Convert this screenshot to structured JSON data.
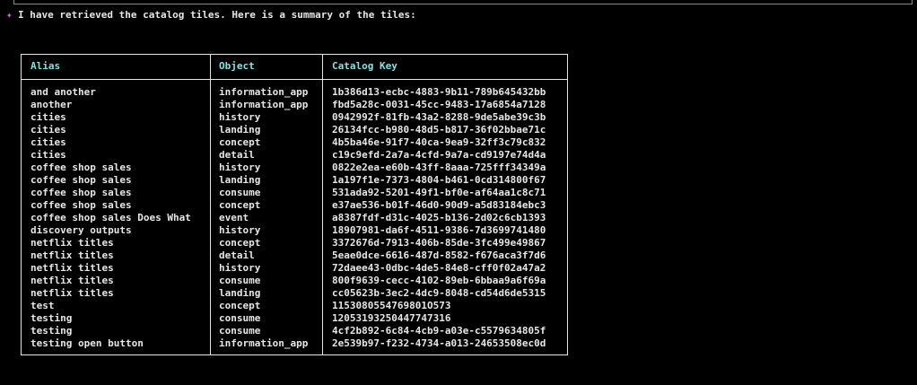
{
  "message": {
    "icon": "sparkle-icon",
    "text": "I have retrieved the catalog tiles. Here is a summary of the tiles:"
  },
  "table": {
    "headers": [
      "Alias",
      "Object",
      "Catalog Key"
    ],
    "rows": [
      [
        "and another",
        "information_app",
        "1b386d13-ecbc-4883-9b11-789b645432bb"
      ],
      [
        "another",
        "information_app",
        "fbd5a28c-0031-45cc-9483-17a6854a7128"
      ],
      [
        "cities",
        "history",
        "0942992f-81fb-43a2-8288-9de5abe39c3b"
      ],
      [
        "cities",
        "landing",
        "26134fcc-b980-48d5-b817-36f02bbae71c"
      ],
      [
        "cities",
        "concept",
        "4b5ba46e-91f7-40ca-9ea9-32ff3c79c832"
      ],
      [
        "cities",
        "detail",
        "c19c9efd-2a7a-4cfd-9a7a-cd9197e74d4a"
      ],
      [
        "coffee shop sales",
        "history",
        "0822e2ea-e60b-43ff-8aaa-725fff34349a"
      ],
      [
        "coffee shop sales",
        "landing",
        "1a197f1e-7373-4804-b461-0cd314800f67"
      ],
      [
        "coffee shop sales",
        "consume",
        "531ada92-5201-49f1-bf0e-af64aa1c8c71"
      ],
      [
        "coffee shop sales",
        "concept",
        "e37ae536-b01f-46d0-90d9-a5d83184ebc3"
      ],
      [
        "coffee shop sales Does What",
        "event",
        "a8387fdf-d31c-4025-b136-2d02c6cb1393"
      ],
      [
        "discovery outputs",
        "history",
        "18907981-da6f-4511-9386-7d3699741480"
      ],
      [
        "netflix titles",
        "concept",
        "3372676d-7913-406b-85de-3fc499e49867"
      ],
      [
        "netflix titles",
        "detail",
        "5eae0dce-6616-487d-8582-f676aca3f7d6"
      ],
      [
        "netflix titles",
        "history",
        "72daee43-0dbc-4de5-84e8-cff0f02a47a2"
      ],
      [
        "netflix titles",
        "consume",
        "800f9639-cecc-4102-89eb-6bbaa9a6f69a"
      ],
      [
        "netflix titles",
        "landing",
        "cc05623b-3ec2-4dc9-8048-cd54d6de5315"
      ],
      [
        "test",
        "concept",
        "1153080554769801O573"
      ],
      [
        "testing",
        "consume",
        "12053193250447747316"
      ],
      [
        "testing",
        "consume",
        "4cf2b892-6c84-4cb9-a03e-c5579634805f"
      ],
      [
        "testing open button",
        "information_app",
        "2e539b97-f232-4734-a013-24653508ec0d"
      ]
    ]
  },
  "colors": {
    "background": "#000000",
    "text": "#e6e6e6",
    "header": "#7fe3e3",
    "sparkle": "#d96bd9"
  }
}
